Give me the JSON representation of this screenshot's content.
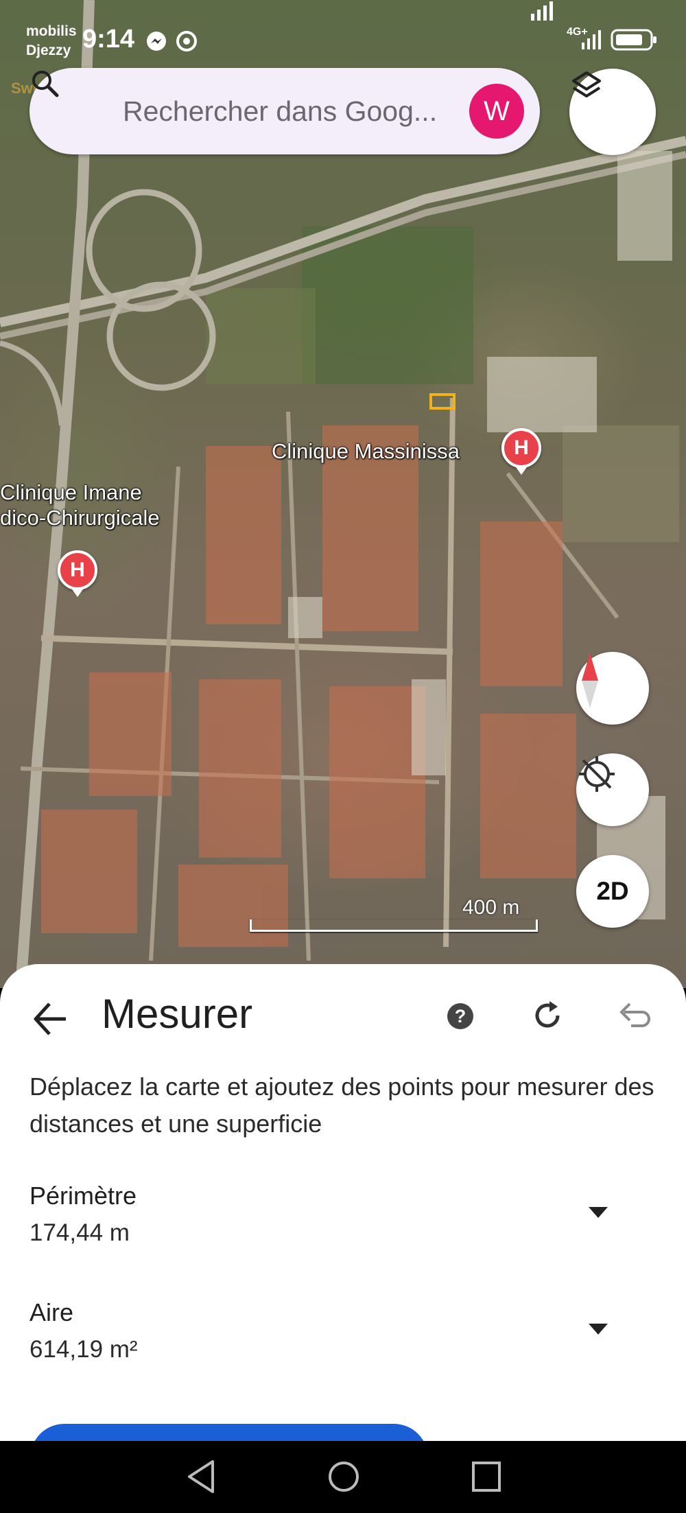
{
  "status_bar": {
    "carrier_line1": "mobilis",
    "carrier_line2": "Djezzy",
    "time": "9:14",
    "network": "4G+",
    "icons": [
      "messenger-icon",
      "whatsapp-icon",
      "signal-icon",
      "battery-icon"
    ]
  },
  "watermark": "Swiga | سويقة",
  "search": {
    "placeholder": "Rechercher dans Goog...",
    "avatar_letter": "W"
  },
  "map": {
    "labels": {
      "clinic_massinissa": "Clinique Massinissa",
      "clinic_imane_line1": "Clinique Imane",
      "clinic_imane_line2": "dico-Chirurgicale"
    },
    "pin_letter": "H",
    "scale_label": "400 m",
    "view_mode_button": "2D"
  },
  "measure_sheet": {
    "title": "Mesurer",
    "help_label": "?",
    "description": "Déplacez la carte et ajoutez des points pour mesurer des distances et une superficie",
    "perimeter": {
      "label": "Périmètre",
      "value": "174,44 m"
    },
    "area": {
      "label": "Aire",
      "value": "614,19 m²"
    }
  },
  "colors": {
    "accent": "#e5176e",
    "pin": "#e84149",
    "primary": "#1a5fd6",
    "search_bg": "#f4eefb"
  }
}
